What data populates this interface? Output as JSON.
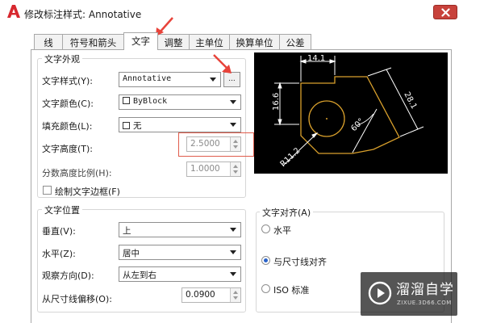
{
  "window": {
    "title": "修改标注样式: Annotative",
    "logo_letter": "A"
  },
  "tabs": [
    {
      "label": "线",
      "active": false
    },
    {
      "label": "符号和箭头",
      "active": false
    },
    {
      "label": "文字",
      "active": true
    },
    {
      "label": "调整",
      "active": false
    },
    {
      "label": "主单位",
      "active": false
    },
    {
      "label": "换算单位",
      "active": false
    },
    {
      "label": "公差",
      "active": false
    }
  ],
  "appearance": {
    "title": "文字外观",
    "text_style_label": "文字样式(Y):",
    "text_style_value": "Annotative",
    "ellipsis_label": "...",
    "text_color_label": "文字颜色(C):",
    "text_color_value": "ByBlock",
    "fill_color_label": "填充颜色(L):",
    "fill_color_value": "无",
    "text_height_label": "文字高度(T):",
    "text_height_value": "2.5000",
    "fraction_label": "分数高度比例(H):",
    "fraction_value": "1.0000",
    "frame_label": "绘制文字边框(F)"
  },
  "placement": {
    "title": "文字位置",
    "vertical_label": "垂直(V):",
    "vertical_value": "上",
    "horizontal_label": "水平(Z):",
    "horizontal_value": "居中",
    "direction_label": "观察方向(D):",
    "direction_value": "从左到右",
    "offset_label": "从尺寸线偏移(O):",
    "offset_value": "0.0900"
  },
  "alignment": {
    "title": "文字对齐(A)",
    "options": [
      {
        "label": "水平",
        "selected": false
      },
      {
        "label": "与尺寸线对齐",
        "selected": true
      },
      {
        "label": "ISO 标准",
        "selected": false
      }
    ]
  },
  "preview": {
    "dim_top": "14.1",
    "dim_left": "16.6",
    "dim_right": "28.1",
    "dim_angle": "60°",
    "dim_radius": "R11.2"
  },
  "watermark": {
    "title": "溜溜自学",
    "url": "ZIXUE.3D66.COM"
  },
  "colors": {
    "accent_red": "#e05c4c",
    "preview_bg": "#000000",
    "preview_shape": "#d9a02c",
    "preview_dims": "#ffffff"
  }
}
